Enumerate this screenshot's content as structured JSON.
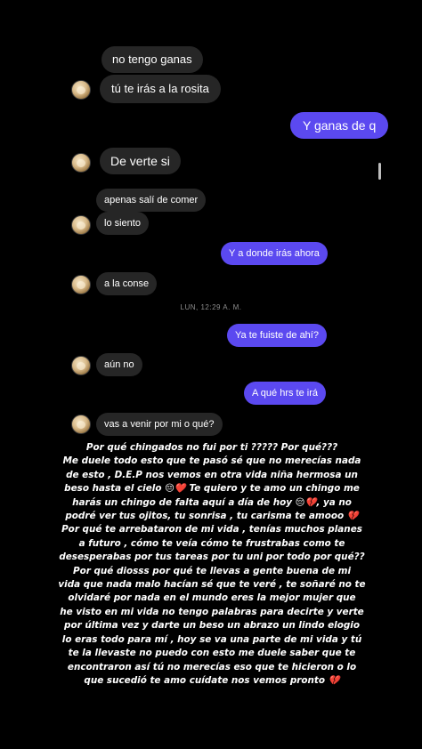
{
  "messages": [
    {
      "text": "no tengo ganas",
      "side": "in"
    },
    {
      "text": "tú te irás a la rosita",
      "side": "in"
    },
    {
      "text": "Y ganas de q",
      "side": "out"
    },
    {
      "text": "De verte si",
      "side": "in"
    },
    {
      "text": "apenas salí de comer",
      "side": "in"
    },
    {
      "text": "lo siento",
      "side": "in"
    },
    {
      "text": "Y a donde irás ahora",
      "side": "out"
    },
    {
      "text": "a la conse",
      "side": "in"
    },
    {
      "text": "Ya te fuiste de ahí?",
      "side": "out"
    },
    {
      "text": "aún no",
      "side": "in"
    },
    {
      "text": "A qué hrs te irá",
      "side": "out"
    },
    {
      "text": "vas a venir por mi o qué?",
      "side": "in"
    }
  ],
  "timestamp": "LUN, 12:29 A. M.",
  "colors": {
    "outgoing_bubble": "#5b49f0",
    "incoming_bubble": "#262626",
    "background": "#000000"
  },
  "caption": "Por qué chingados no fui por ti ????? Por qué???\nMe duele todo esto que te pasó sé que no merecías nada\nde esto , D.E.P nos vemos en otra vida niña hermosa un\nbeso hasta el cielo 😔❤️ Te quiero y te amo un chingo me\nharás un chingo de falta aquí a día de hoy 😔💔, ya no\npodré ver tus ojitos, tu sonrisa , tu carisma te amooo 💔\nPor qué te arrebataron de mi vida , tenías muchos planes\na futuro , cómo te veía cómo te frustrabas como te\ndesesperabas por tus tareas por tu uni por todo por qué??\nPor qué diosss por qué te llevas a gente buena de mi\nvida que nada malo hacían sé que te veré , te soñaré no te\nolvidaré por nada en el mundo eres la mejor mujer que\nhe visto en mi vida no tengo palabras para decirte y verte\npor última vez y darte un beso un abrazo un lindo elogio\nlo eras todo para mí , hoy se va una parte de mi vida y tú\nte la llevaste no puedo con esto me duele saber que te\nencontraron así tú no merecías eso que te hicieron o lo\nque sucedió  te amo cuídate nos vemos pronto 💔"
}
